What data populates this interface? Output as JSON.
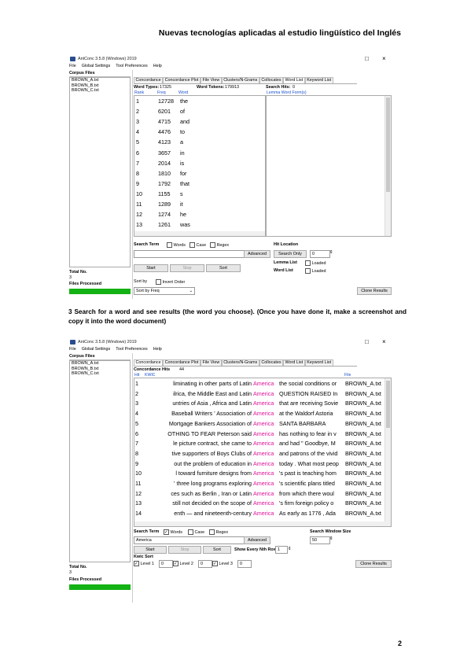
{
  "doc": {
    "header": "Nuevas tecnologías aplicadas al estudio lingüístico del Inglés",
    "instruction": "3 Search for a word and see results (the word you choose). (Once you have done it, make a screenshot and copy it into the word document)",
    "page_number": "2"
  },
  "app": {
    "title": "AntConc 3.5.8 (Windows) 2019",
    "menu": [
      "File",
      "Global Settings",
      "Tool Preferences",
      "Help"
    ],
    "corpus_files_label": "Corpus Files",
    "files": [
      "BROWN_A.txt",
      "BROWN_B.txt",
      "BROWN_C.txt"
    ],
    "total_no_label": "Total No.",
    "total_no_value": "3",
    "files_processed_label": "Files Processed",
    "tabs": [
      "Concordance",
      "Concordance Plot",
      "File View",
      "Clusters/N-Grams",
      "Collocates",
      "Word List",
      "Keyword List"
    ]
  },
  "wordlist": {
    "word_types_label": "Word Types:",
    "word_types": "17325",
    "word_tokens_label": "Word Tokens:",
    "word_tokens": "179913",
    "search_hits_label": "Search Hits:",
    "search_hits": "0",
    "col_rank": "Rank",
    "col_freq": "Freq",
    "col_word": "Word",
    "col_lemma": "Lemma Word Form(s)",
    "rows": [
      [
        "1",
        "12728",
        "the"
      ],
      [
        "2",
        "6201",
        "of"
      ],
      [
        "3",
        "4715",
        "and"
      ],
      [
        "4",
        "4476",
        "to"
      ],
      [
        "5",
        "4123",
        "a"
      ],
      [
        "6",
        "3657",
        "in"
      ],
      [
        "7",
        "2014",
        "is"
      ],
      [
        "8",
        "1810",
        "for"
      ],
      [
        "9",
        "1792",
        "that"
      ],
      [
        "10",
        "1155",
        "s"
      ],
      [
        "11",
        "1289",
        "it"
      ],
      [
        "12",
        "1274",
        "he"
      ],
      [
        "13",
        "1261",
        "was"
      ]
    ],
    "search_term_label": "Search Term",
    "words_label": "Words",
    "case_label": "Case",
    "regex_label": "Regex",
    "advanced_btn": "Advanced",
    "hit_location_label": "Hit Location",
    "search_only_btn": "Search Only",
    "hit_value": "0",
    "lemma_list_label": "Lemma List",
    "word_list_label": "Word List",
    "loaded_label": "Loaded",
    "start_btn": "Start",
    "stop_btn": "Stop",
    "sort_btn": "Sort",
    "sort_by_label": "Sort by",
    "invert_order_label": "Invert Order",
    "sort_select": "Sort by Freq",
    "clone_btn": "Clone Results"
  },
  "concordance": {
    "hits_label": "Concordance Hits",
    "hits": "44",
    "col_hit": "Hit",
    "col_kwic": "KWIC",
    "col_file": "File",
    "rows": [
      [
        "1",
        "liminating in other parts of Latin",
        "America",
        "the social conditions or",
        "BROWN_A.txt"
      ],
      [
        "2",
        "ilrica, the Middle East and Latin",
        "America",
        "QUESTION RAISED In",
        "BROWN_A.txt"
      ],
      [
        "3",
        "untries of Asia , Africa and Latin",
        "America",
        "that are receiving Sovie",
        "BROWN_A.txt"
      ],
      [
        "4",
        "Baseball Writers ' Association of",
        "America",
        "at the Waldorf Astoria",
        "BROWN_A.txt"
      ],
      [
        "5",
        "Mortgage Bankers Association of",
        "America",
        "SANTA BARBARA",
        "BROWN_A.txt"
      ],
      [
        "6",
        "OTHING TO FEAR Peterson said",
        "America",
        "has nothing to fear in v",
        "BROWN_A.txt"
      ],
      [
        "7",
        "le picture contract, she came to",
        "America",
        "and had \" Goodbye, M",
        "BROWN_A.txt"
      ],
      [
        "8",
        "tive supporters of Boys Clubs of",
        "America",
        "and patrons of the vivid",
        "BROWN_A.txt"
      ],
      [
        "9",
        "out the problem of education in",
        "America",
        "today . What most peop",
        "BROWN_A.txt"
      ],
      [
        "10",
        "l toward furniture designs from",
        "America",
        "'s past is teaching hom",
        "BROWN_A.txt"
      ],
      [
        "11",
        "' three long programs exploring",
        "America",
        "'s scientific plans titled",
        "BROWN_A.txt"
      ],
      [
        "12",
        "ces such as Berlin , Iran or Latin",
        "America",
        "from which there woul",
        "BROWN_A.txt"
      ],
      [
        "13",
        "still not decided on the scope of",
        "America",
        "'s firm foreign policy o",
        "BROWN_A.txt"
      ],
      [
        "14",
        "enth — and nineteenth-century",
        "America",
        "As early as 1776 , Ada",
        "BROWN_A.txt"
      ]
    ],
    "search_term_label": "Search Term",
    "words_label": "Words",
    "case_label": "Case",
    "regex_label": "Regex",
    "search_value": "America",
    "advanced_btn": "Advanced",
    "window_size_label": "Search Window Size",
    "window_size_value": "50",
    "start_btn": "Start",
    "stop_btn": "Stop",
    "sort_btn": "Sort",
    "show_every_label": "Show Every Nth Row",
    "show_every_value": "1",
    "kwic_sort_label": "Kwic Sort",
    "level1_label": "Level 1",
    "level1_value": "0",
    "level2_label": "Level 2",
    "level2_value": "0",
    "level3_label": "Level 3",
    "level3_value": "0",
    "clone_btn": "Clone Results"
  },
  "colors": {
    "accent": "#1a4fd1",
    "hit": "#e0149a",
    "progress": "#14b214"
  }
}
